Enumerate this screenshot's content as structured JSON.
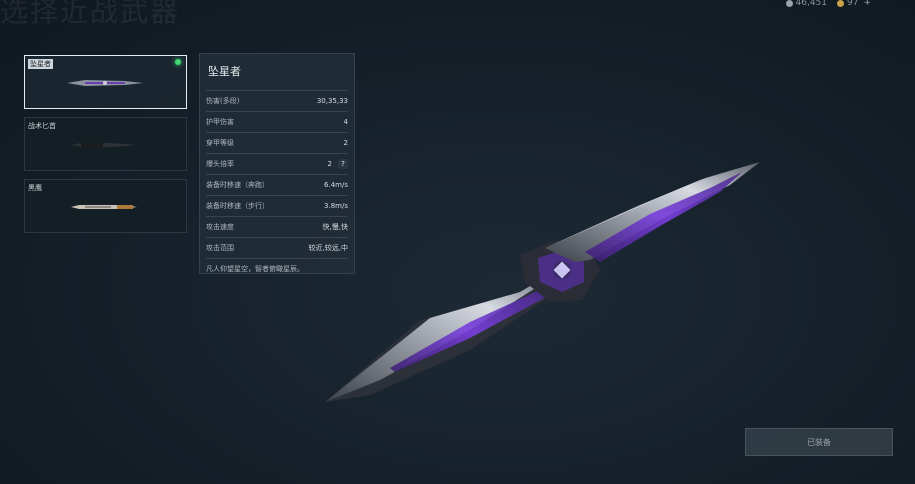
{
  "header": {
    "bg_title": "选择近战武器"
  },
  "currency": {
    "silver": "46,451",
    "gold": "97",
    "plus": "+"
  },
  "weapons": [
    {
      "name": "坠星者",
      "selected": true,
      "equipped": true
    },
    {
      "name": "战术匕首",
      "selected": false,
      "equipped": false
    },
    {
      "name": "黑鹰",
      "selected": false,
      "equipped": false
    }
  ],
  "stats": {
    "title": "坠星者",
    "rows": [
      {
        "label": "伤害(多段)",
        "value": "30,35,33"
      },
      {
        "label": "护甲伤害",
        "value": "4"
      },
      {
        "label": "穿甲等级",
        "value": "2"
      },
      {
        "label": "爆头倍率",
        "value": "2",
        "help": "?"
      },
      {
        "label": "装备时移速（奔跑）",
        "value": "6.4m/s"
      },
      {
        "label": "装备时移速（步行）",
        "value": "3.8m/s"
      },
      {
        "label": "攻击速度",
        "value": "快,慢,快"
      },
      {
        "label": "攻击范围",
        "value": "较近,较远,中"
      }
    ],
    "quote": "凡人仰望星空，智者俯瞰星辰。"
  },
  "equip_button": {
    "label": "已装备"
  },
  "colors": {
    "accent_violet": "#7b3fe0",
    "equipped_dot": "#3fd474",
    "background": "#16212b"
  }
}
